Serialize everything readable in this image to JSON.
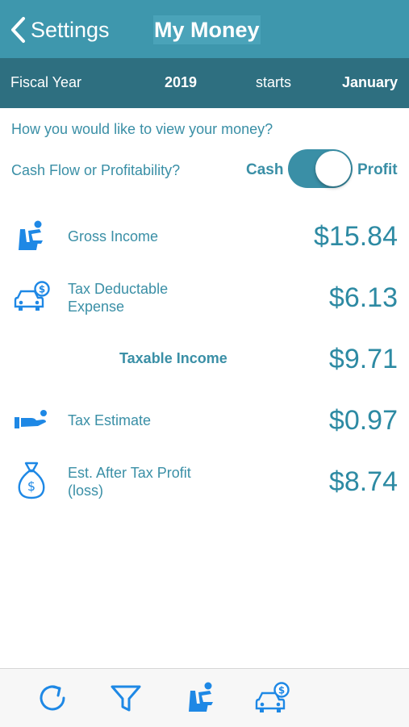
{
  "nav": {
    "back_label": "Settings",
    "title": "My Money"
  },
  "fiscal": {
    "label": "Fiscal Year",
    "year": "2019",
    "starts": "starts",
    "month": "January"
  },
  "question": "How you would like to view your money?",
  "view_mode": {
    "question": "Cash Flow or Profitability?",
    "option_cash": "Cash",
    "option_profit": "Profit",
    "selected": "Profit"
  },
  "rows": [
    {
      "icon": "seated-person-icon",
      "label": "Gross Income",
      "value": "$15.84"
    },
    {
      "icon": "car-dollar-icon",
      "label": "Tax Deductable Expense",
      "value": "$6.13"
    },
    {
      "label": "Taxable Income",
      "value": "$9.71"
    },
    {
      "icon": "hand-coin-icon",
      "label": "Tax Estimate",
      "value": "$0.97"
    },
    {
      "icon": "money-bag-icon",
      "label": "Est. After Tax Profit (loss)",
      "value": "$8.74"
    }
  ],
  "tabbar": [
    "refresh-icon",
    "filter-icon",
    "seated-person-icon",
    "car-dollar-icon"
  ],
  "colors": {
    "accent": "#3a8fa6",
    "nav": "#3e97ad",
    "fiscal_bar": "#2e6f80",
    "icon_blue": "#1e88e5"
  }
}
